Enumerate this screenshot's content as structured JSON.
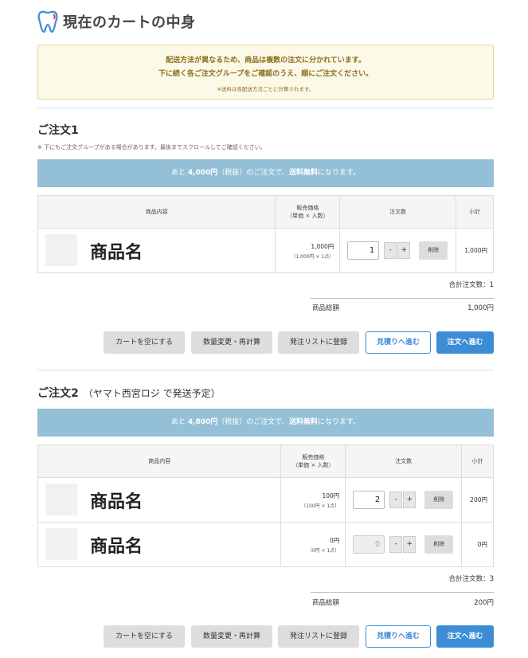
{
  "header": {
    "title": "現在のカートの中身",
    "icon": "tooth-icon",
    "accent": "#3d8dd6",
    "accent2": "#e23d3d"
  },
  "notice": {
    "line1": "配送方法が異なるため、商品は複数の注文に分かれています。",
    "line2": "下に続く各ご注文グループをご確認のうえ、順にご注文ください。",
    "line3": "※送料は各配送方法ごとに計算されます。"
  },
  "orders": [
    {
      "title": "ご注文1",
      "subtitle": "",
      "note": "※ 下にもご注文グループがある場合があります。最後までスクロールしてご確認ください。",
      "banner": {
        "pre": "あと",
        "amount": "4,000円",
        "mid": "（税抜）のご注文で、",
        "strong": "送料無料",
        "post": "になります。"
      },
      "headers": {
        "product": "商品内容",
        "price_l1": "販売価格",
        "price_l2": "（単価 × 入数）",
        "qty": "注文数",
        "subtotal": "小計"
      },
      "items": [
        {
          "name": "商品名",
          "price": "1,000円",
          "price_detail": "（1,000円 × 1点）",
          "qty": "1",
          "minus": "-",
          "plus": "+",
          "delete": "削除",
          "subtotal": "1,000円",
          "disabled": false
        }
      ],
      "total_count": "合計注文数：1",
      "sum_label": "商品総額",
      "sum_value": "1,000円",
      "buttons": {
        "empty": "カートを空にする",
        "recalc": "数量変更・再計算",
        "list": "発注リストに登録",
        "quote": "見積りへ進む",
        "order": "注文へ進む"
      }
    },
    {
      "title": "ご注文2",
      "subtitle": "（ヤマト西宮ロジ で発送予定）",
      "note": "",
      "banner": {
        "pre": "あと",
        "amount": "4,800円",
        "mid": "（税抜）のご注文で、",
        "strong": "送料無料",
        "post": "になります。"
      },
      "headers": {
        "product": "商品内容",
        "price_l1": "販売価格",
        "price_l2": "（単価 × 入数）",
        "qty": "注文数",
        "subtotal": "小計"
      },
      "items": [
        {
          "name": "商品名",
          "price": "100円",
          "price_detail": "（100円 × 1点）",
          "qty": "2",
          "minus": "-",
          "plus": "+",
          "delete": "削除",
          "subtotal": "200円",
          "disabled": false
        },
        {
          "name": "商品名",
          "price": "0円",
          "price_detail": "（0円 × 1点）",
          "qty": "0",
          "minus": "-",
          "plus": "+",
          "delete": "削除",
          "subtotal": "0円",
          "disabled": true
        }
      ],
      "total_count": "合計注文数：3",
      "sum_label": "商品総額",
      "sum_value": "200円",
      "buttons": {
        "empty": "カートを空にする",
        "recalc": "数量変更・再計算",
        "list": "発注リストに登録",
        "quote": "見積りへ進む",
        "order": "注文へ進む"
      }
    }
  ]
}
